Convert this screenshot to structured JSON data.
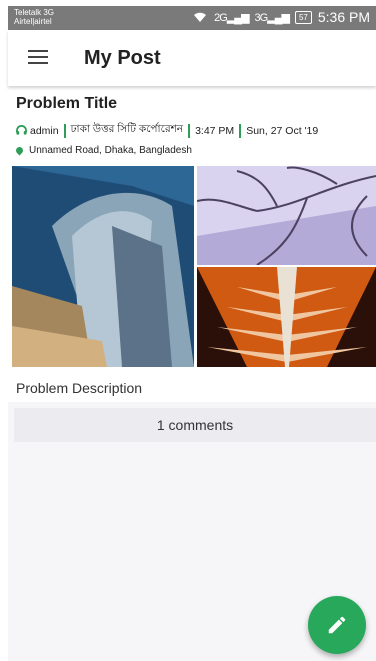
{
  "status_bar": {
    "carrier_line1": "Teletalk 3G",
    "carrier_line2": "Airtel|airtel",
    "network1": "2G",
    "network2": "3G",
    "battery": "57",
    "time": "5:36 PM"
  },
  "app_bar": {
    "title": "My Post"
  },
  "post": {
    "title": "Problem Title",
    "author": "admin",
    "organization": "ঢাকা উত্তর সিটি কর্পোরেশন",
    "time": "3:47 PM",
    "date": "Sun, 27 Oct '19",
    "location": "Unnamed Road, Dhaka, Bangladesh",
    "description": "Problem Description",
    "comments_label": "1 comments"
  },
  "colors": {
    "accent": "#27a85a",
    "status_bar": "#7a7a7a"
  },
  "icons": [
    "menu-icon",
    "headset-icon",
    "location-pin-icon",
    "edit-pencil-icon",
    "wifi-icon",
    "signal-icon",
    "battery-icon"
  ]
}
